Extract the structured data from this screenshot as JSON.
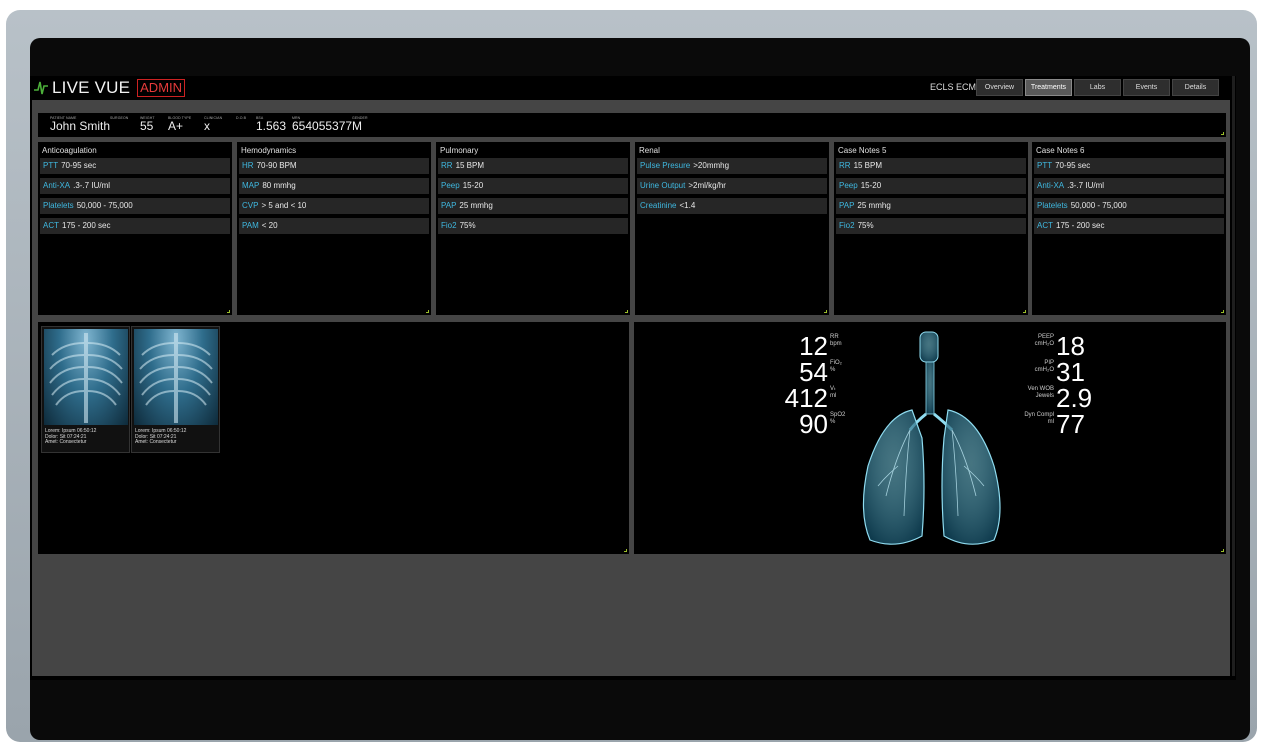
{
  "app": {
    "title": "LIVE VUE",
    "admin_label": "ADMIN",
    "system_label": "ECLS ECMO"
  },
  "nav": [
    {
      "label": "Overview"
    },
    {
      "label": "Treatments"
    },
    {
      "label": "Labs"
    },
    {
      "label": "Events"
    },
    {
      "label": "Details"
    }
  ],
  "patient": {
    "name_label": "PATIENT NAME",
    "name": "John Smith",
    "surgeon_label": "SURGEON",
    "weight_label": "WEIGHT",
    "weight": "55",
    "blood_label": "BLOOD TYPE",
    "blood": "A+",
    "clinician_label": "CLINICIAN",
    "clinician": "x",
    "dob_label": "D.O.B",
    "bsa_label": "BSA",
    "bsa": "1.563",
    "mrn_label": "MRN",
    "mrn": "654055377",
    "gender_label": "GENDER",
    "gender": "M"
  },
  "cards": [
    {
      "title": "Anticoagulation",
      "rows": [
        {
          "key": "PTT",
          "value": "70-95 sec"
        },
        {
          "key": "Anti-XA",
          "value": ".3-.7 IU/ml"
        },
        {
          "key": "Platelets",
          "value": "50,000 - 75,000"
        },
        {
          "key": "ACT",
          "value": "175 - 200 sec"
        }
      ]
    },
    {
      "title": "Hemodynamics",
      "rows": [
        {
          "key": "HR",
          "value": "70-90 BPM"
        },
        {
          "key": "MAP",
          "value": "80 mmhg"
        },
        {
          "key": "CVP",
          "value": "> 5 and < 10"
        },
        {
          "key": "PAM",
          "value": "< 20"
        }
      ]
    },
    {
      "title": "Pulmonary",
      "rows": [
        {
          "key": "RR",
          "value": "15 BPM"
        },
        {
          "key": "Peep",
          "value": "15-20"
        },
        {
          "key": "PAP",
          "value": "25 mmhg"
        },
        {
          "key": "Fio2",
          "value": "75%"
        }
      ]
    },
    {
      "title": "Renal",
      "rows": [
        {
          "key": "Pulse Presure",
          "value": ">20mmhg"
        },
        {
          "key": "Urine Output",
          "value": ">2ml/kg/hr"
        },
        {
          "key": "Creatinine",
          "value": "<1.4"
        }
      ]
    },
    {
      "title": "Case Notes 5",
      "rows": [
        {
          "key": "RR",
          "value": "15 BPM"
        },
        {
          "key": "Peep",
          "value": "15-20"
        },
        {
          "key": "PAP",
          "value": "25 mmhg"
        },
        {
          "key": "Fio2",
          "value": "75%"
        }
      ]
    },
    {
      "title": "Case Notes 6",
      "rows": [
        {
          "key": "PTT",
          "value": "70-95 sec"
        },
        {
          "key": "Anti-XA",
          "value": ".3-.7 IU/ml"
        },
        {
          "key": "Platelets",
          "value": "50,000 - 75,000"
        },
        {
          "key": "ACT",
          "value": "175 - 200 sec"
        }
      ]
    }
  ],
  "xrays": [
    {
      "line1": "Lorem: Ipsum 06:50:12",
      "line2": "Dolor: Sit 07:24:21",
      "line3": "Amet: Consectetur"
    },
    {
      "line1": "Lorem: Ipsum 06:50:12",
      "line2": "Dolor: Sit 07:24:21",
      "line3": "Amet: Consectetur"
    }
  ],
  "vitals_left": [
    {
      "value": "12",
      "label": "RR",
      "unit": "bpm"
    },
    {
      "value": "54",
      "label": "FiO₂",
      "unit": "%"
    },
    {
      "value": "412",
      "label": "Vₜ",
      "unit": "ml"
    },
    {
      "value": "90",
      "label": "SpO2",
      "unit": "%"
    }
  ],
  "vitals_right": [
    {
      "value": "18",
      "label": "PEEP",
      "unit": "cmH₂O"
    },
    {
      "value": "31",
      "label": "PIP",
      "unit": "cmH₂O"
    },
    {
      "value": "2.9",
      "label": "Ven WOB",
      "unit": "Jewels"
    },
    {
      "value": "77",
      "label": "Dyn Compl",
      "unit": "ml"
    }
  ],
  "colors": {
    "accent": "#3fb8e0",
    "admin": "#e53a3a",
    "logo": "#4caf3a",
    "corner": "#9bbf2a"
  }
}
